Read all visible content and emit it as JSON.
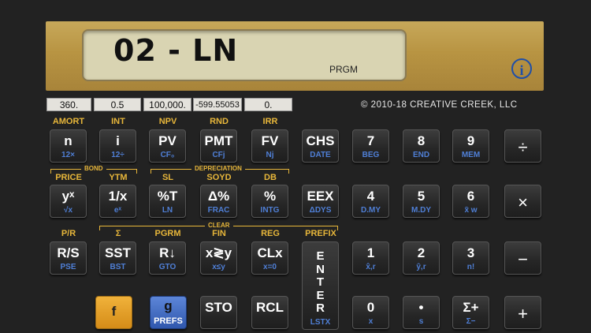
{
  "display": {
    "value": "02 - LN",
    "annunciator": "PRGM"
  },
  "registers": [
    "360.",
    "0.5",
    "100,000.",
    "-599.55053",
    "0."
  ],
  "copyright": "© 2010-18 CREATIVE CREEK, LLC",
  "info_label": "i",
  "groups": {
    "bond": "BOND",
    "depreciation": "DEPRECIATION",
    "clear": "CLEAR"
  },
  "row1": [
    {
      "gold": "AMORT",
      "main": "n",
      "blue": "12×"
    },
    {
      "gold": "INT",
      "main": "i",
      "blue": "12÷"
    },
    {
      "gold": "NPV",
      "main": "PV",
      "blue": "CF₀"
    },
    {
      "gold": "RND",
      "main": "PMT",
      "blue": "CFj"
    },
    {
      "gold": "IRR",
      "main": "FV",
      "blue": "Nj"
    },
    {
      "gold": "",
      "main": "CHS",
      "blue": "DATE"
    },
    {
      "gold": "",
      "main": "7",
      "blue": "BEG"
    },
    {
      "gold": "",
      "main": "8",
      "blue": "END"
    },
    {
      "gold": "",
      "main": "9",
      "blue": "MEM"
    },
    {
      "gold": "",
      "main": "÷",
      "blue": ""
    }
  ],
  "row2": [
    {
      "gold": "PRICE",
      "main": "yˣ",
      "blue": "√x"
    },
    {
      "gold": "YTM",
      "main": "1/x",
      "blue": "eˣ"
    },
    {
      "gold": "SL",
      "main": "%T",
      "blue": "LN"
    },
    {
      "gold": "SOYD",
      "main": "Δ%",
      "blue": "FRAC"
    },
    {
      "gold": "DB",
      "main": "%",
      "blue": "INTG"
    },
    {
      "gold": "",
      "main": "EEX",
      "blue": "ΔDYS"
    },
    {
      "gold": "",
      "main": "4",
      "blue": "D.MY"
    },
    {
      "gold": "",
      "main": "5",
      "blue": "M.DY"
    },
    {
      "gold": "",
      "main": "6",
      "blue": "x̄ w"
    },
    {
      "gold": "",
      "main": "×",
      "blue": ""
    }
  ],
  "row3": [
    {
      "gold": "P/R",
      "main": "R/S",
      "blue": "PSE"
    },
    {
      "gold": "Σ",
      "main": "SST",
      "blue": "BST"
    },
    {
      "gold": "PGRM",
      "main": "R↓",
      "blue": "GTO"
    },
    {
      "gold": "FIN",
      "main": "x≷y",
      "blue": "x≤y"
    },
    {
      "gold": "REG",
      "main": "CLx",
      "blue": "x=0"
    },
    {
      "gold": "PREFIX",
      "main": "",
      "blue": ""
    },
    {
      "gold": "",
      "main": "1",
      "blue": "x̂,r"
    },
    {
      "gold": "",
      "main": "2",
      "blue": "ŷ,r"
    },
    {
      "gold": "",
      "main": "3",
      "blue": "n!"
    },
    {
      "gold": "",
      "main": "−",
      "blue": ""
    }
  ],
  "enter": {
    "letters": [
      "E",
      "N",
      "T",
      "E",
      "R"
    ],
    "blue": "LSTX"
  },
  "row4": [
    {
      "main": "f",
      "blue": ""
    },
    {
      "main": "g",
      "blue": "PREFS"
    },
    {
      "main": "STO",
      "blue": ""
    },
    {
      "main": "RCL",
      "blue": ""
    },
    {
      "main": "0",
      "blue": "x"
    },
    {
      "main": "•",
      "blue": "s"
    },
    {
      "main": "Σ+",
      "blue": "Σ−"
    },
    {
      "main": "+",
      "blue": ""
    }
  ]
}
